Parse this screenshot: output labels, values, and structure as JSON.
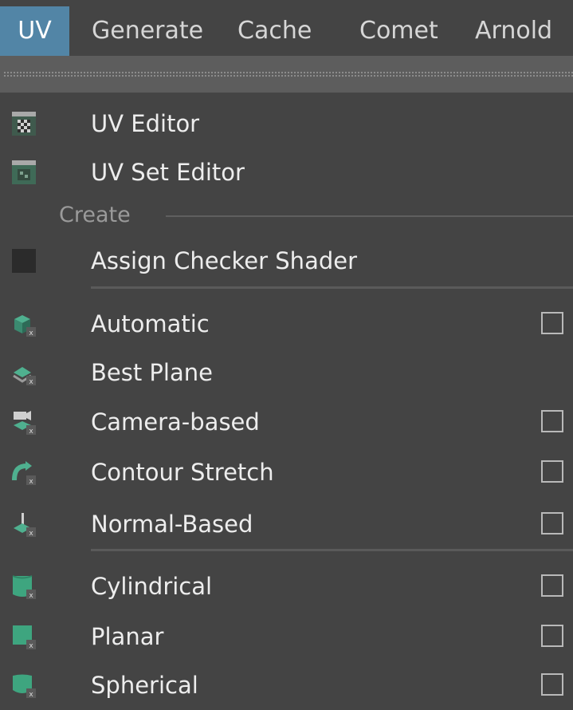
{
  "menubar": {
    "items": [
      "UV",
      "Generate",
      "Cache",
      "Comet",
      "Arnold"
    ],
    "active_color": "#5285a6"
  },
  "menu": {
    "items": [
      {
        "label": "UV Editor",
        "icon": "uv-editor-icon",
        "option_box": false
      },
      {
        "label": "UV Set Editor",
        "icon": "uv-set-editor-icon",
        "option_box": false
      }
    ],
    "section": {
      "label": "Create"
    },
    "create_items": [
      {
        "label": "Assign Checker Shader",
        "icon": "checker-shader-icon",
        "option_box": false
      },
      {
        "label": "Automatic",
        "icon": "automatic-mapping-icon",
        "option_box": true
      },
      {
        "label": "Best Plane",
        "icon": "best-plane-icon",
        "option_box": false
      },
      {
        "label": "Camera-based",
        "icon": "camera-based-icon",
        "option_box": true
      },
      {
        "label": "Contour Stretch",
        "icon": "contour-stretch-icon",
        "option_box": true
      },
      {
        "label": "Normal-Based",
        "icon": "normal-based-icon",
        "option_box": true
      },
      {
        "label": "Cylindrical",
        "icon": "cylindrical-icon",
        "option_box": true
      },
      {
        "label": "Planar",
        "icon": "planar-icon",
        "option_box": true
      },
      {
        "label": "Spherical",
        "icon": "spherical-icon",
        "option_box": true
      }
    ]
  }
}
